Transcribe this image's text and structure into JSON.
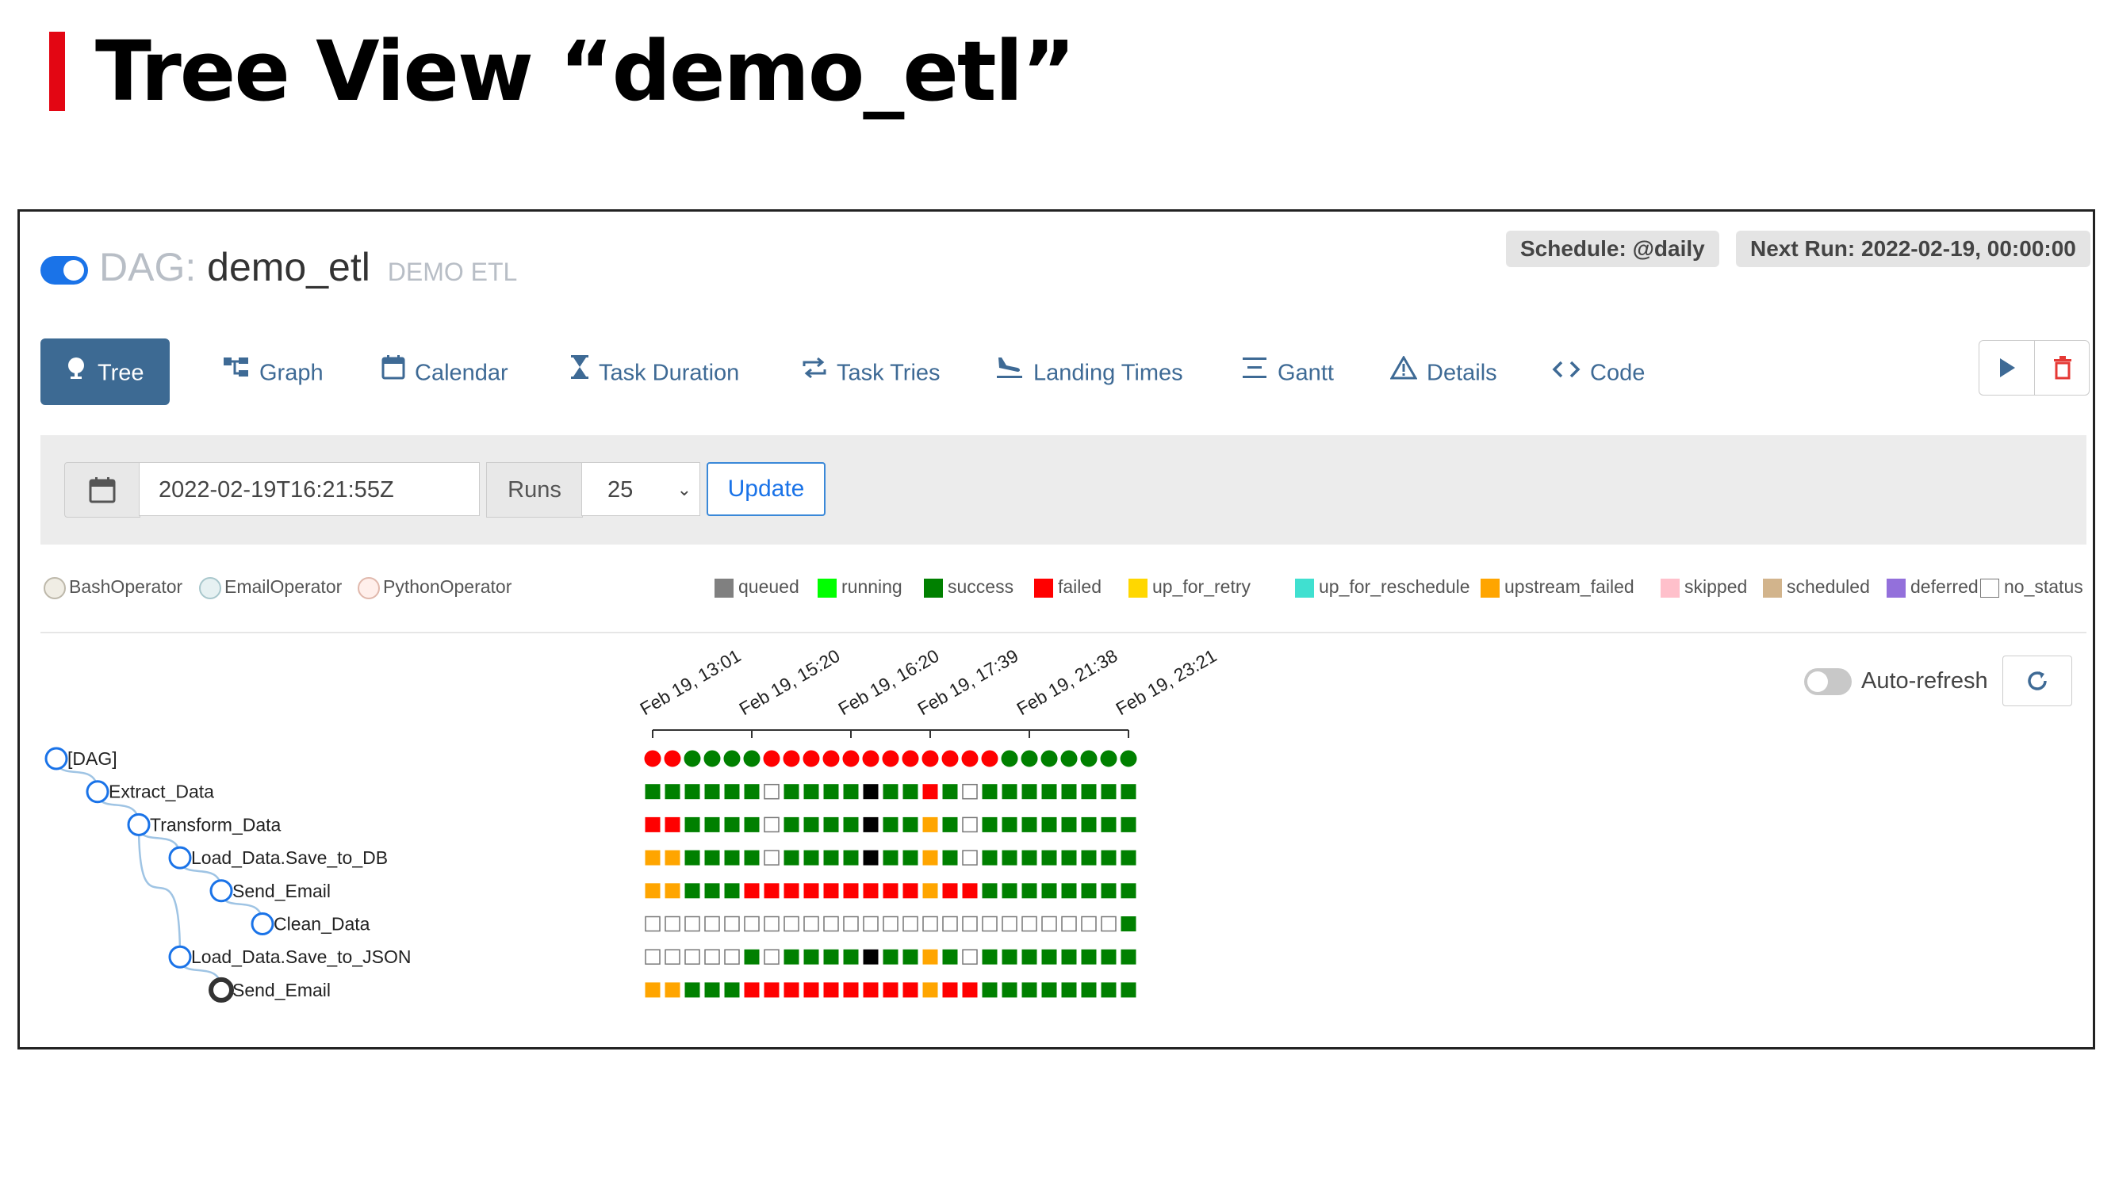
{
  "slide": {
    "title": "Tree View “demo_etl”"
  },
  "header": {
    "dag_prefix": "DAG:",
    "dag_id": "demo_etl",
    "dag_description": "DEMO ETL",
    "schedule": "Schedule: @daily",
    "next_run": "Next Run: 2022-02-19, 00:00:00"
  },
  "tabs": [
    {
      "id": "tree",
      "label": "Tree",
      "icon": "tree-icon",
      "active": true
    },
    {
      "id": "graph",
      "label": "Graph",
      "icon": "graph-icon"
    },
    {
      "id": "calendar",
      "label": "Calendar",
      "icon": "calendar-icon"
    },
    {
      "id": "task-duration",
      "label": "Task Duration",
      "icon": "hourglass-icon"
    },
    {
      "id": "task-tries",
      "label": "Task Tries",
      "icon": "repeat-icon"
    },
    {
      "id": "landing-times",
      "label": "Landing Times",
      "icon": "plane-landing-icon"
    },
    {
      "id": "gantt",
      "label": "Gantt",
      "icon": "gantt-icon"
    },
    {
      "id": "details",
      "label": "Details",
      "icon": "warning-triangle-icon"
    },
    {
      "id": "code",
      "label": "Code",
      "icon": "code-icon"
    }
  ],
  "controls": {
    "base_date": "2022-02-19T16:21:55Z",
    "runs_label": "Runs",
    "runs_value": "25",
    "update_label": "Update",
    "auto_refresh_label": "Auto-refresh",
    "auto_refresh_on": false
  },
  "operators": [
    {
      "name": "BashOperator",
      "color": "#f0ede4",
      "border": "#bdb8aa"
    },
    {
      "name": "EmailOperator",
      "color": "#e6f1f2",
      "border": "#a8c7cc"
    },
    {
      "name": "PythonOperator",
      "color": "#ffefeb",
      "border": "#e0b8ac"
    }
  ],
  "states": [
    {
      "name": "queued",
      "color": "#808080"
    },
    {
      "name": "running",
      "color": "#00ff00"
    },
    {
      "name": "success",
      "color": "#008000"
    },
    {
      "name": "failed",
      "color": "#ff0000"
    },
    {
      "name": "up_for_retry",
      "color": "#ffd700"
    },
    {
      "name": "up_for_reschedule",
      "color": "#40e0d0"
    },
    {
      "name": "upstream_failed",
      "color": "#ffa500"
    },
    {
      "name": "skipped",
      "color": "#ffc0cb"
    },
    {
      "name": "scheduled",
      "color": "#d2b48c"
    },
    {
      "name": "deferred",
      "color": "#9370db"
    },
    {
      "name": "no_status",
      "color": "#ffffff"
    }
  ],
  "state_codes": {
    "S": "#008000",
    "F": "#ff0000",
    "U": "#ffa500",
    "N": "#ffffff",
    "B": "#000000"
  },
  "timeline_labels": [
    "Feb 19, 13:01",
    "Feb 19, 15:20",
    "Feb 19, 16:20",
    "Feb 19, 17:39",
    "Feb 19, 21:38",
    "Feb 19, 23:21"
  ],
  "tree": [
    {
      "label": "[DAG]",
      "depth": 0,
      "kind": "dag",
      "runs": "FFSSSSFFFFFFFFFFFFSSSSSSS"
    },
    {
      "label": "Extract_Data",
      "depth": 1,
      "kind": "task",
      "runs": "SSSSSSNSSSSBSSFSNSSSSSSSS"
    },
    {
      "label": "Transform_Data",
      "depth": 2,
      "kind": "task",
      "runs": "FFSSSSNSSSSBSSUSNSSSSSSSS"
    },
    {
      "label": "Load_Data.Save_to_DB",
      "depth": 3,
      "kind": "task",
      "runs": "UUSSSSNSSSSBSSUSNSSSSSSSS"
    },
    {
      "label": "Send_Email",
      "depth": 4,
      "kind": "task",
      "runs": "UUSSSFFFFFFFFFUFFSSSSSSSS"
    },
    {
      "label": "Clean_Data",
      "depth": 5,
      "kind": "task",
      "runs": "NNNNNNNNNNNNNNNNNNNNNNNNS"
    },
    {
      "label": "Load_Data.Save_to_JSON",
      "depth": 3,
      "kind": "task",
      "runs": "NNNNNSNSSSSBSSUSNSSSSSSSS"
    },
    {
      "label": "Send_Email",
      "depth": 4,
      "kind": "task-dark",
      "runs": "UUSSSFFFFFFFFFUFFSSSSSSSS"
    }
  ]
}
